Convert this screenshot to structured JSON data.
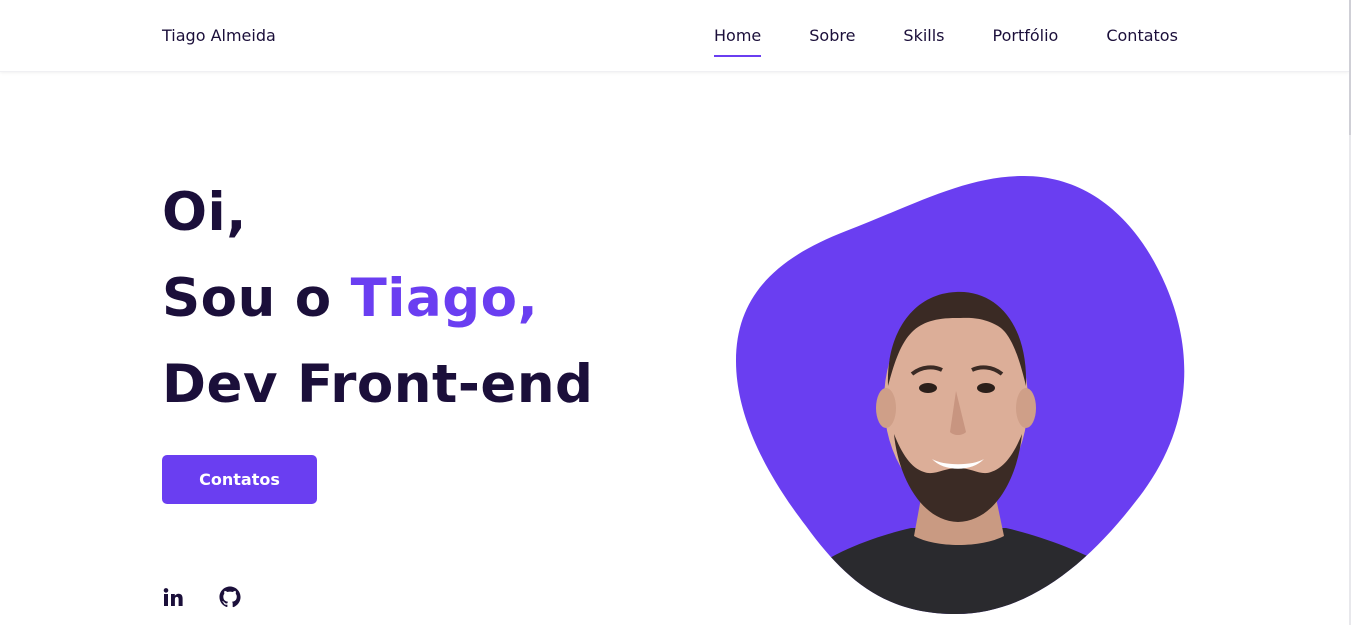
{
  "header": {
    "brand": "Tiago Almeida",
    "nav": [
      {
        "label": "Home",
        "active": true
      },
      {
        "label": "Sobre",
        "active": false
      },
      {
        "label": "Skills",
        "active": false
      },
      {
        "label": "Portfólio",
        "active": false
      },
      {
        "label": "Contatos",
        "active": false
      }
    ]
  },
  "hero": {
    "line1": "Oi,",
    "line2_prefix": "Sou o ",
    "line2_accent": "Tiago,",
    "line3": "Dev Front-end",
    "cta_label": "Contatos"
  },
  "socials": [
    {
      "icon": "linkedin-icon"
    },
    {
      "icon": "github-icon"
    }
  ],
  "colors": {
    "accent": "#6a3ef1",
    "text": "#1b0f3a",
    "background": "#ffffff"
  }
}
